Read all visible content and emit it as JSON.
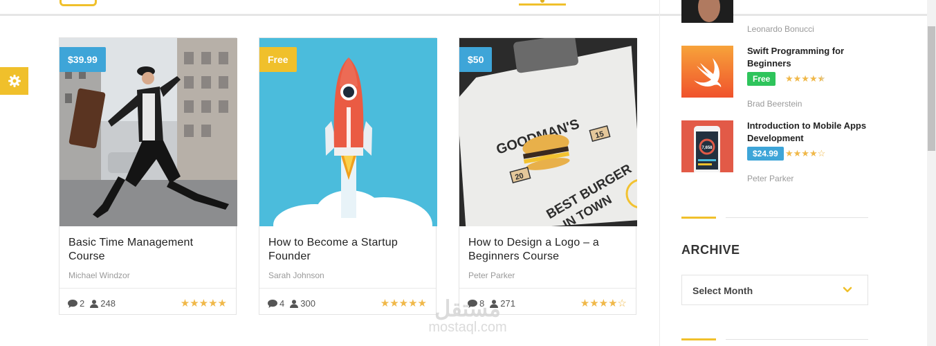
{
  "courses": [
    {
      "price": "$39.99",
      "price_color": "#3ea5d8",
      "title": "Basic Time Management Course",
      "author": "Michael Windzor",
      "comments": "2",
      "students": "248",
      "rating": 5
    },
    {
      "price": "Free",
      "price_color": "#f0c02b",
      "title": "How to Become a Startup Founder",
      "author": "Sarah Johnson",
      "comments": "4",
      "students": "300",
      "rating": 5
    },
    {
      "price": "$50",
      "price_color": "#3ea5d8",
      "title": "How to Design a Logo – a Beginners Course",
      "author": "Peter Parker",
      "comments": "8",
      "students": "271",
      "rating": 4
    }
  ],
  "logo_card": {
    "brand_line1": "GOODMAN'S",
    "brand_line2": "BEST BURGER",
    "brand_line3": "IN TOWN",
    "num_left": "20",
    "num_right": "15"
  },
  "sidebar": {
    "top_author": "Leonardo Bonucci",
    "items": [
      {
        "title": "Swift Programming for Beginners",
        "badge": "Free",
        "badge_color": "#2ec45b",
        "rating": 4.5,
        "author": "Brad Beerstein"
      },
      {
        "title": "Introduction to Mobile Apps Development",
        "badge": "$24.99",
        "badge_color": "#3ea5d8",
        "rating": 4,
        "author": "Peter Parker",
        "phone_text": "7,658"
      }
    ],
    "archive_title": "ARCHIVE",
    "archive_select": "Select Month"
  },
  "colors": {
    "accent": "#f0c02b",
    "blue": "#3ea5d8",
    "star": "#f0b849",
    "green": "#2ec45b"
  },
  "icons": [
    "gear-icon",
    "comment-icon",
    "user-icon",
    "star-icon",
    "chevron-down-icon",
    "swift-logo-icon",
    "rocket-icon"
  ],
  "watermark": {
    "arabic": "مستقل",
    "latin": "mostaql.com"
  }
}
